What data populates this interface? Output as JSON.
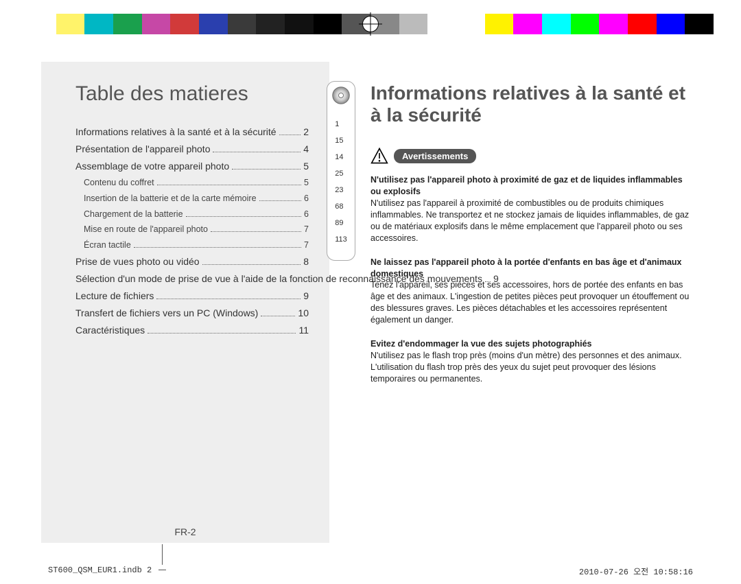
{
  "colorbar": [
    "#ffffff",
    "#fff36a",
    "#00b7c4",
    "#1aa04d",
    "#c648a6",
    "#d13a3a",
    "#2a3fae",
    "#3a3a3a",
    "#222222",
    "#111111",
    "#000000",
    "#555555",
    "#888888",
    "#bbbbbb",
    "#ffffff",
    "#ffffff",
    "#fff200",
    "#ff00ff",
    "#00ffff",
    "#00ff00",
    "#ff00ff",
    "#ff0000",
    "#0000ff",
    "#000000"
  ],
  "toc": {
    "title": "Table des matieres",
    "items": [
      {
        "label": "Informations relatives à la santé et à la sécurité",
        "page": "2"
      },
      {
        "label": "Présentation de l'appareil photo",
        "page": "4"
      },
      {
        "label": "Assemblage de votre appareil photo",
        "page": "5"
      },
      {
        "label": "Contenu du coffret",
        "page": "5",
        "sub": true
      },
      {
        "label": "Insertion de la batterie et de la carte mémoire",
        "page": "6",
        "sub": true
      },
      {
        "label": "Chargement de la batterie",
        "page": "6",
        "sub": true
      },
      {
        "label": "Mise en route de l'appareil photo",
        "page": "7",
        "sub": true
      },
      {
        "label": "Écran tactile",
        "page": "7",
        "sub": true
      },
      {
        "label": "Prise de vues photo ou vidéo",
        "page": "8"
      },
      {
        "label": "Sélection d'un mode de prise de vue à l'aide de la fonction de reconnaissance des mouvements",
        "page": "9"
      },
      {
        "label": "Lecture de fichiers",
        "page": "9"
      },
      {
        "label": "Transfert de fichiers vers un PC (Windows)",
        "page": "10"
      },
      {
        "label": "Caractéristiques",
        "page": "11"
      }
    ],
    "side_numbers": [
      "1",
      "15",
      "14",
      "25",
      "23",
      "68",
      "89",
      "113"
    ],
    "page_number": "FR-2"
  },
  "right": {
    "title": "Informations relatives à la santé et à la sécurité",
    "warn_label": "Avertissements",
    "sections": [
      {
        "head": "N'utilisez pas l'appareil photo à proximité de gaz et de liquides inflammables ou explosifs",
        "body": "N'utilisez pas l'appareil à proximité de combustibles ou de produits chimiques inflammables. Ne transportez et ne stockez jamais de liquides inflammables, de gaz ou de matériaux explosifs dans le même emplacement que l'appareil photo ou ses accessoires."
      },
      {
        "head": "Ne laissez pas l'appareil photo à la portée d'enfants en bas âge et d'animaux domestiques",
        "body": "Tenez l'appareil, ses pièces et ses accessoires, hors de portée des enfants en bas âge et des animaux. L'ingestion de petites pièces peut provoquer un étouffement ou des blessures graves. Les pièces détachables et les accessoires représentent également un danger."
      },
      {
        "head": "Evitez d'endommager la vue des sujets photographiés",
        "body": "N'utilisez pas le flash trop près (moins d'un mètre) des personnes et des animaux. L'utilisation du flash trop près des yeux du sujet peut provoquer des lésions temporaires ou permanentes."
      }
    ]
  },
  "footer": {
    "left": "ST600_QSM_EUR1.indb   2",
    "right": "2010-07-26   오전 10:58:16"
  }
}
